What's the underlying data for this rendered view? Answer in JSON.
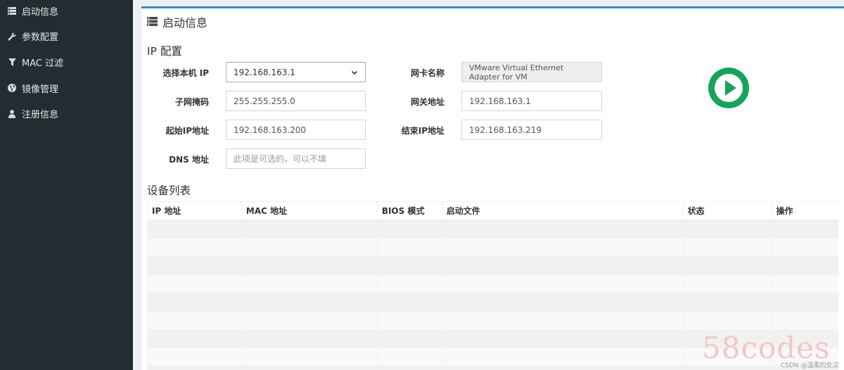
{
  "sidebar": {
    "items": [
      {
        "label": "启动信息",
        "icon": "server-icon"
      },
      {
        "label": "参数配置",
        "icon": "wrench-icon"
      },
      {
        "label": "MAC 过滤",
        "icon": "filter-icon"
      },
      {
        "label": "镜像管理",
        "icon": "globe-icon"
      },
      {
        "label": "注册信息",
        "icon": "user-icon"
      }
    ]
  },
  "panel": {
    "title": "启动信息",
    "ip_config_title": "IP 配置",
    "device_list_title": "设备列表"
  },
  "form": {
    "select_ip": {
      "label": "选择本机 IP",
      "value": "192.168.163.1"
    },
    "nic_name": {
      "label": "网卡名称",
      "value": "VMware Virtual Ethernet Adapter for VM"
    },
    "subnet_mask": {
      "label": "子网掩码",
      "value": "255.255.255.0"
    },
    "gateway": {
      "label": "网关地址",
      "value": "192.168.163.1"
    },
    "start_ip": {
      "label": "起始IP地址",
      "value": "192.168.163.200"
    },
    "end_ip": {
      "label": "结束IP地址",
      "value": "192.168.163.219"
    },
    "dns": {
      "label": "DNS 地址",
      "value": "",
      "placeholder": "此项是可选的，可以不填"
    }
  },
  "table": {
    "headers": [
      "IP 地址",
      "MAC 地址",
      "BIOS 模式",
      "启动文件",
      "状态",
      "操作"
    ]
  },
  "watermark": {
    "text": "58codes",
    "sub": "CSDN @温柔的女汉子"
  },
  "colors": {
    "sidebar_bg": "#222d32",
    "accent": "#3c8dbc",
    "play_button": "#17a45a"
  }
}
